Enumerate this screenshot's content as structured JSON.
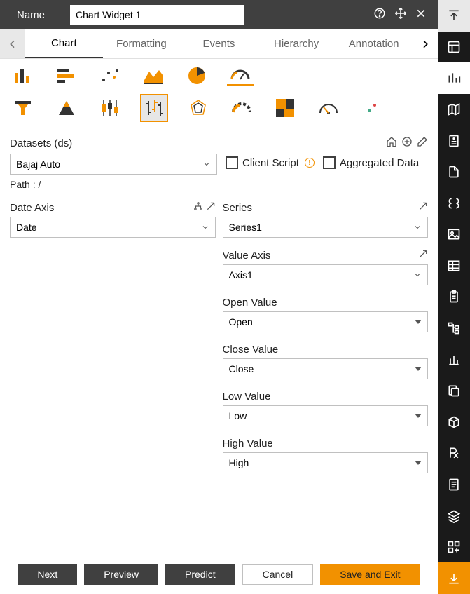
{
  "title": {
    "label": "Name",
    "value": "Chart Widget 1"
  },
  "tabs": [
    "Chart",
    "Formatting",
    "Events",
    "Hierarchy",
    "Annotation"
  ],
  "datasets": {
    "label": "Datasets (ds)",
    "selected": "Bajaj Auto",
    "path_label": "Path :  /",
    "client_script_label": "Client Script",
    "aggregated_label": "Aggregated Data"
  },
  "left_col": {
    "date_axis": {
      "label": "Date Axis",
      "value": "Date"
    }
  },
  "right_col": {
    "series": {
      "label": "Series",
      "value": "Series1"
    },
    "value_axis": {
      "label": "Value Axis",
      "value": "Axis1"
    },
    "open": {
      "label": "Open Value",
      "value": "Open"
    },
    "close": {
      "label": "Close Value",
      "value": "Close"
    },
    "low": {
      "label": "Low Value",
      "value": "Low"
    },
    "high": {
      "label": "High Value",
      "value": "High"
    }
  },
  "footer": {
    "next": "Next",
    "preview": "Preview",
    "predict": "Predict",
    "cancel": "Cancel",
    "save": "Save and Exit"
  }
}
